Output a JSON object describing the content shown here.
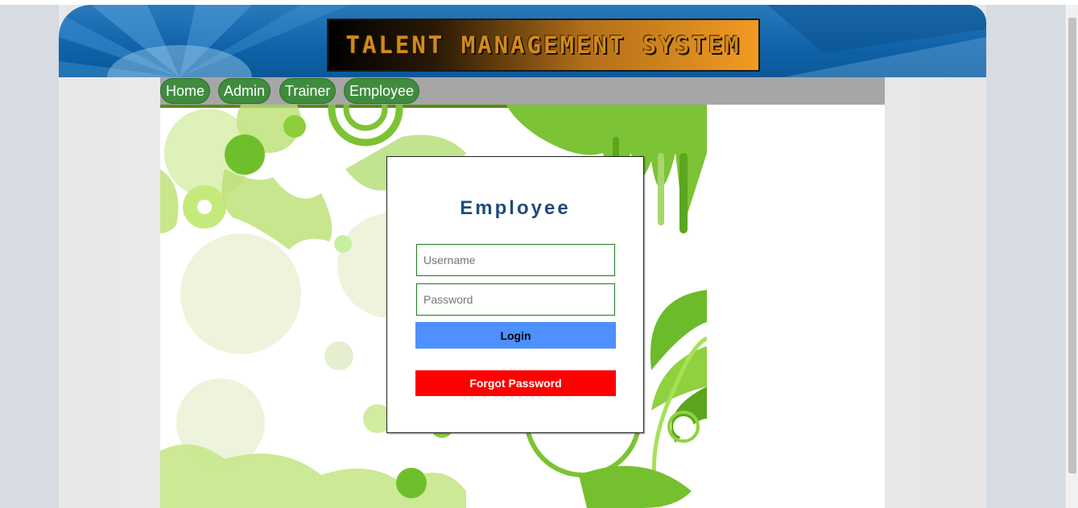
{
  "header": {
    "logo_text": "TALENT MANAGEMENT SYSTEM"
  },
  "nav": {
    "items": [
      {
        "label": "Home"
      },
      {
        "label": "Admin"
      },
      {
        "label": "Trainer"
      },
      {
        "label": "Employee"
      }
    ]
  },
  "login": {
    "title": "Employee",
    "username_placeholder": "Username",
    "password_placeholder": "Password",
    "login_label": "Login",
    "forgot_label": "Forgot Password"
  },
  "colors": {
    "header_blue": "#0f62a8",
    "nav_green": "#3f8c3f",
    "navbar_gray": "#a6a6a6",
    "title_blue": "#214a7a",
    "login_blue": "#4d90fe",
    "forgot_red": "#ff0000",
    "input_border_green": "#1e7b1e"
  }
}
